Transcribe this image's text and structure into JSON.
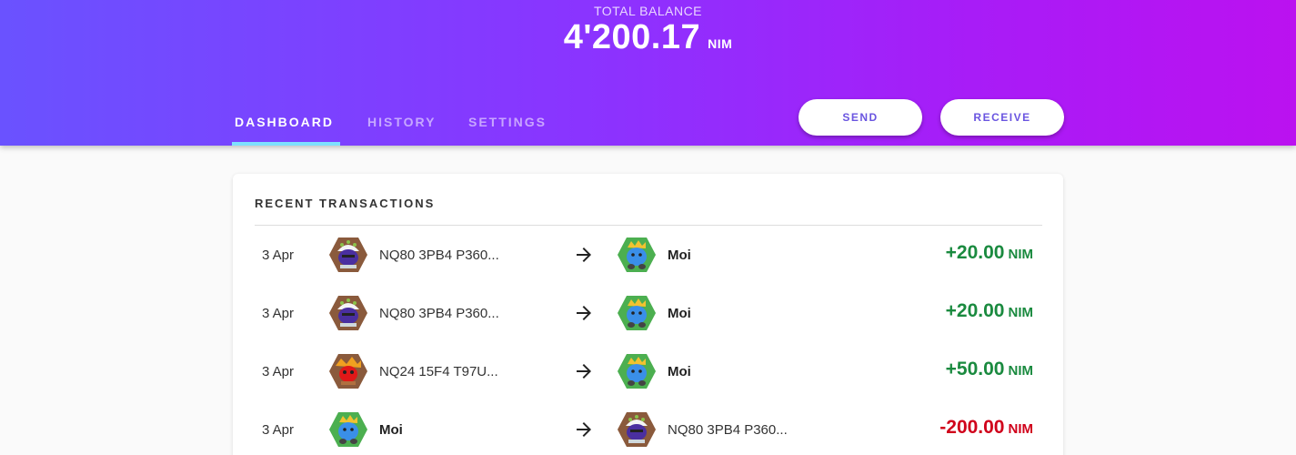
{
  "balance": {
    "label": "TOTAL BALANCE",
    "value": "4'200.17",
    "unit": "NIM"
  },
  "tabs": [
    {
      "label": "DASHBOARD",
      "active": true
    },
    {
      "label": "HISTORY",
      "active": false
    },
    {
      "label": "SETTINGS",
      "active": false
    }
  ],
  "actions": {
    "send_label": "SEND",
    "receive_label": "RECEIVE"
  },
  "colors": {
    "gradient_start": "#6a52ff",
    "gradient_end": "#bb11f0",
    "tab_indicator": "#7ee0ff",
    "incoming": "#1a8a3f",
    "outgoing": "#d0021b"
  },
  "recent_transactions": {
    "title": "RECENT TRANSACTIONS",
    "rows": [
      {
        "date": "3 Apr",
        "from": "NQ80 3PB4 P360...",
        "from_icon": "identicon-brown-purple-icon",
        "to": "Moi",
        "to_icon": "identicon-green-blue-icon",
        "amount": "+20.00",
        "unit": "NIM",
        "direction": "incoming"
      },
      {
        "date": "3 Apr",
        "from": "NQ80 3PB4 P360...",
        "from_icon": "identicon-brown-purple-icon",
        "to": "Moi",
        "to_icon": "identicon-green-blue-icon",
        "amount": "+20.00",
        "unit": "NIM",
        "direction": "incoming"
      },
      {
        "date": "3 Apr",
        "from": "NQ24 15F4 T97U...",
        "from_icon": "identicon-brown-red-icon",
        "to": "Moi",
        "to_icon": "identicon-green-blue-icon",
        "amount": "+50.00",
        "unit": "NIM",
        "direction": "incoming"
      },
      {
        "date": "3 Apr",
        "from": "Moi",
        "from_icon": "identicon-green-blue-icon",
        "to": "NQ80 3PB4 P360...",
        "to_icon": "identicon-brown-purple-icon",
        "amount": "-200.00",
        "unit": "NIM",
        "direction": "outgoing"
      }
    ]
  }
}
